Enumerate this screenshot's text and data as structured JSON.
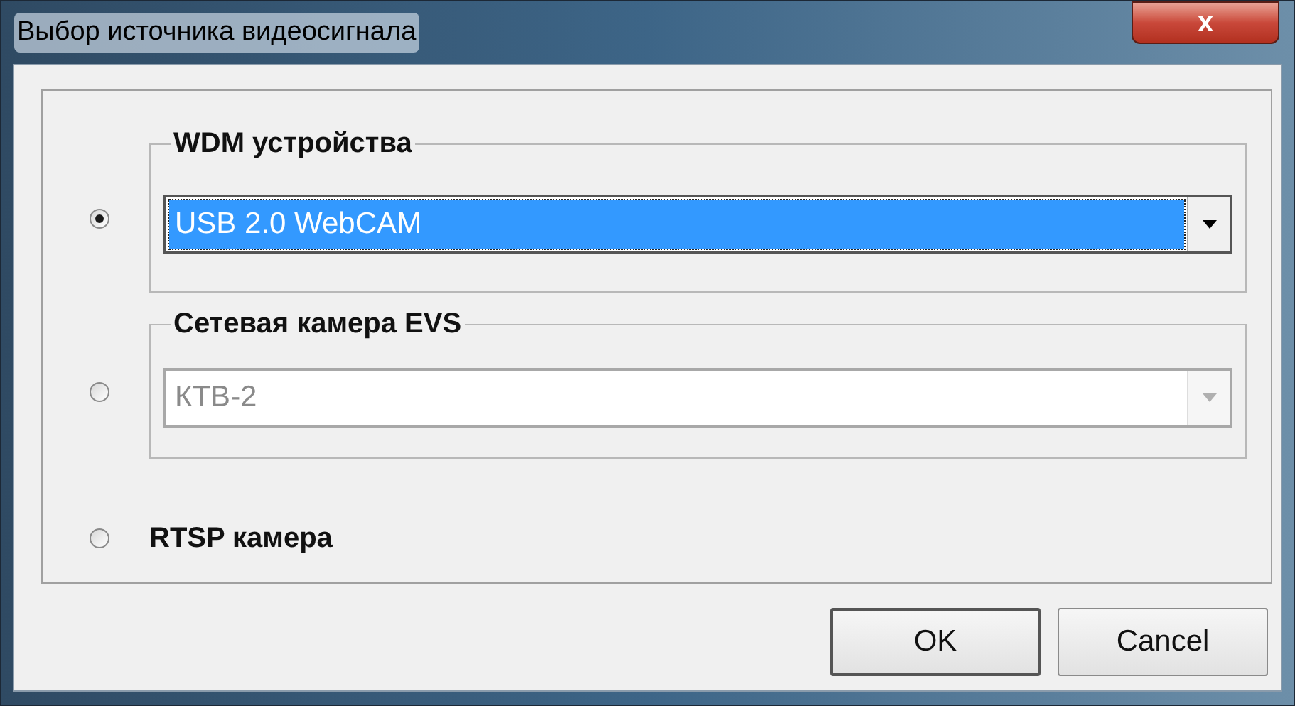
{
  "window": {
    "title": "Выбор источника видеосигнала",
    "close": "x"
  },
  "options": [
    {
      "kind": "group",
      "title": "WDM устройства",
      "selected": true,
      "combo": {
        "value": "USB 2.0 WebCAM",
        "disabled": false,
        "focused": true
      }
    },
    {
      "kind": "group",
      "title": "Сетевая камера EVS",
      "selected": false,
      "combo": {
        "value": "КТВ-2",
        "disabled": true,
        "focused": false
      }
    },
    {
      "kind": "plain",
      "label": "RTSP камера",
      "selected": false
    }
  ],
  "buttons": [
    {
      "label": "OK",
      "default": true
    },
    {
      "label": "Cancel",
      "default": false
    }
  ]
}
